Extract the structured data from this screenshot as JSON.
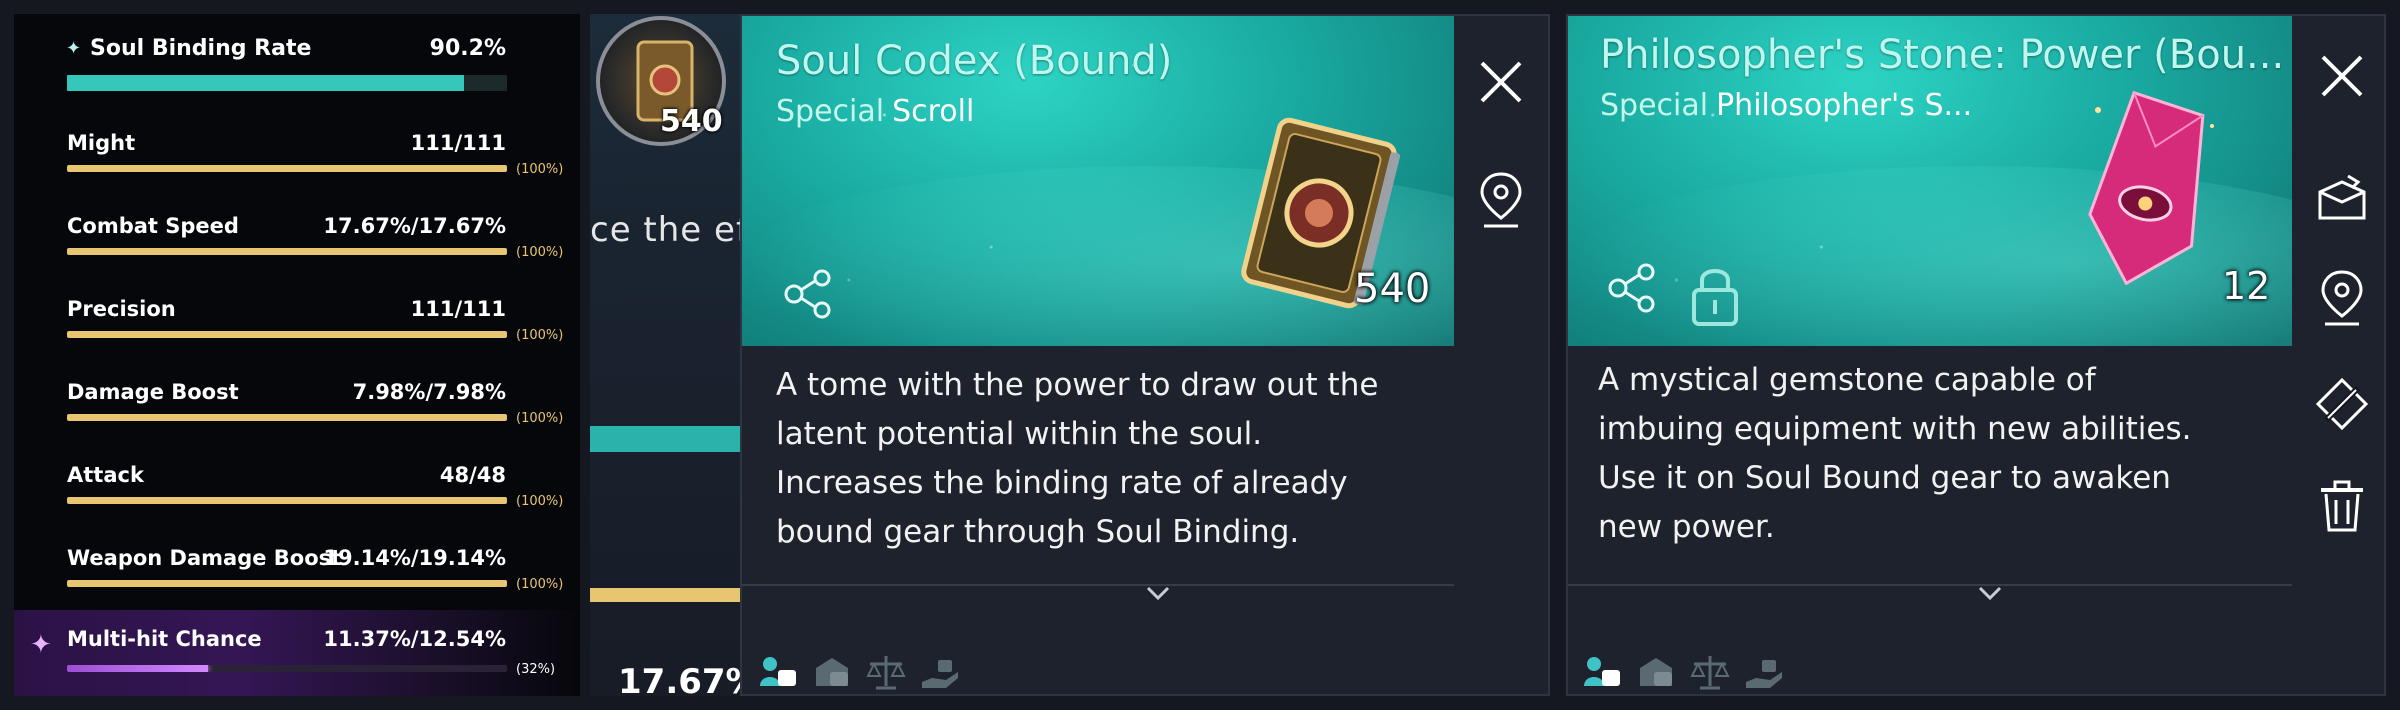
{
  "stats": {
    "soul_binding": {
      "label": "Soul Binding Rate",
      "value": "90.2%",
      "fill": 0.902
    },
    "rows": [
      {
        "label": "Might",
        "value": "111/111",
        "pct": "(100%)",
        "fill": 1.0
      },
      {
        "label": "Combat Speed",
        "value": "17.67%/17.67%",
        "pct": "(100%)",
        "fill": 1.0
      },
      {
        "label": "Precision",
        "value": "111/111",
        "pct": "(100%)",
        "fill": 1.0
      },
      {
        "label": "Damage Boost",
        "value": "7.98%/7.98%",
        "pct": "(100%)",
        "fill": 1.0
      },
      {
        "label": "Attack",
        "value": "48/48",
        "pct": "(100%)",
        "fill": 1.0
      },
      {
        "label": "Weapon Damage Boost",
        "value": "19.14%/19.14%",
        "pct": "(100%)",
        "fill": 1.0
      }
    ],
    "multi_hit": {
      "label": "Multi-hit Chance",
      "value": "11.37%/12.54%",
      "pct": "(32%)",
      "fill": 0.32
    }
  },
  "background": {
    "item_count": "540",
    "partial_text": "ce the eff",
    "partial_pct": "17.67%"
  },
  "cards": [
    {
      "title": "Soul Codex (Bound)",
      "grade": "Special",
      "type": "Scroll",
      "count": "540",
      "description": "A tome with the power to draw out the\nlatent potential within the soul.\nIncreases the binding rate of already\nbound gear through Soul Binding."
    },
    {
      "title": "Philosopher's Stone: Power (Bou...",
      "grade": "Special",
      "type": "Philosopher's S...",
      "count": "12",
      "description": "A mystical gemstone capable of\nimbuing equipment with new abilities.\nUse it on Soul Bound gear to awaken\nnew power."
    }
  ],
  "icons": {
    "close": "close-icon",
    "locate": "locate-pin-icon",
    "share": "share-icon",
    "lock": "lock-icon",
    "storage": "storage-box-icon",
    "dismantle": "dismantle-icon",
    "delete": "trash-icon",
    "footer": [
      "character-equip-icon",
      "storage-equip-icon",
      "trade-scale-icon",
      "hand-give-icon"
    ]
  },
  "colors": {
    "teal_accent": "#35c7b9",
    "gold_bar": "#e8c571",
    "purple_highlight": "#b76ae8",
    "header_teal": "#19a9a0",
    "card_body": "#1e222c"
  }
}
